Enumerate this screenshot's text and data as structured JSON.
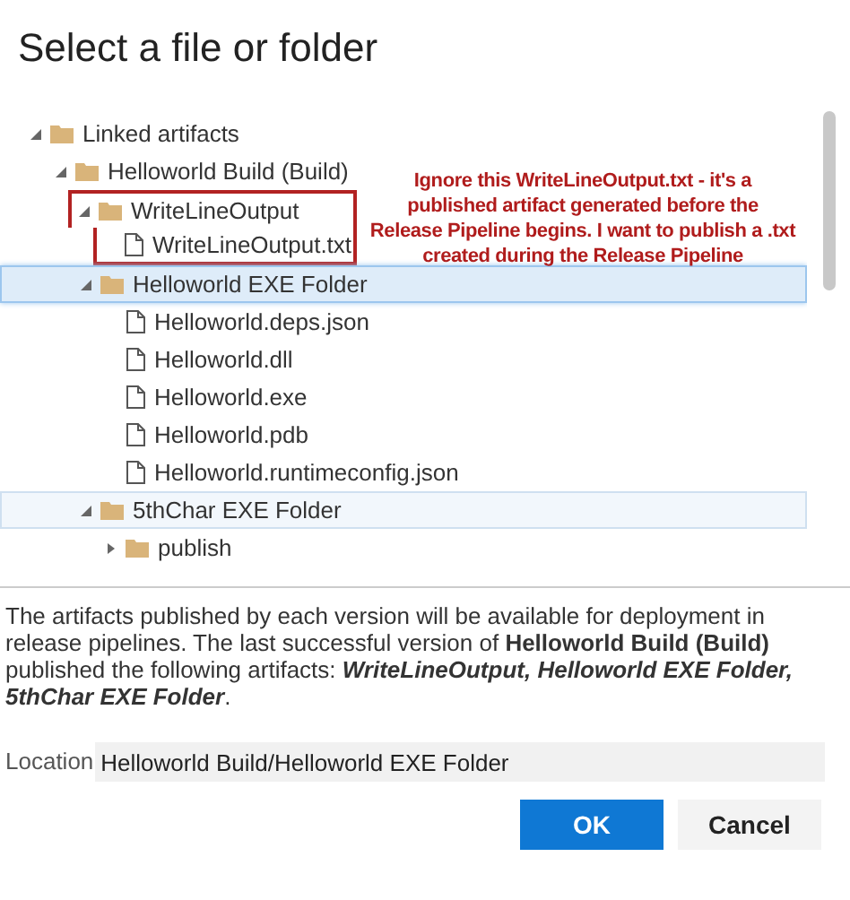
{
  "dialog": {
    "title": "Select a file or folder"
  },
  "tree": [
    {
      "kind": "folder",
      "label": "Linked artifacts",
      "expanded": true,
      "selected": false,
      "hovered": false,
      "annotated": false,
      "children": [
        {
          "kind": "folder",
          "label": "Helloworld Build (Build)",
          "expanded": true,
          "selected": false,
          "hovered": false,
          "annotated": false,
          "children": [
            {
              "kind": "folder",
              "label": "WriteLineOutput",
              "expanded": true,
              "selected": false,
              "hovered": false,
              "annotated": true,
              "children": [
                {
                  "kind": "file",
                  "label": "WriteLineOutput.txt",
                  "selected": false,
                  "hovered": false,
                  "annotated": true
                }
              ]
            },
            {
              "kind": "folder",
              "label": "Helloworld EXE Folder",
              "expanded": true,
              "selected": true,
              "hovered": false,
              "annotated": false,
              "children": [
                {
                  "kind": "file",
                  "label": "Helloworld.deps.json",
                  "selected": false,
                  "hovered": false,
                  "annotated": false
                },
                {
                  "kind": "file",
                  "label": "Helloworld.dll",
                  "selected": false,
                  "hovered": false,
                  "annotated": false
                },
                {
                  "kind": "file",
                  "label": "Helloworld.exe",
                  "selected": false,
                  "hovered": false,
                  "annotated": false
                },
                {
                  "kind": "file",
                  "label": "Helloworld.pdb",
                  "selected": false,
                  "hovered": false,
                  "annotated": false
                },
                {
                  "kind": "file",
                  "label": "Helloworld.runtimeconfig.json",
                  "selected": false,
                  "hovered": false,
                  "annotated": false
                }
              ]
            },
            {
              "kind": "folder",
              "label": "5thChar EXE Folder",
              "expanded": true,
              "selected": false,
              "hovered": true,
              "annotated": false,
              "children": [
                {
                  "kind": "folder",
                  "label": "publish",
                  "expanded": false,
                  "selected": false,
                  "hovered": false,
                  "annotated": false
                }
              ]
            }
          ]
        }
      ]
    }
  ],
  "annotation": {
    "text": "Ignore this WriteLineOutput.txt - it's a published artifact generated before the Release Pipeline begins. I want to publish a .txt created during the Release Pipeline"
  },
  "description": [
    {
      "kind": "plain",
      "text": "The artifacts published by each version will be available for deployment in release pipelines. The last successful version of "
    },
    {
      "kind": "bold",
      "text": "Helloworld Build (Build)"
    },
    {
      "kind": "plain",
      "text": " published the following artifacts: "
    },
    {
      "kind": "bold_italic",
      "text": "WriteLineOutput, Helloworld EXE Folder, 5thChar EXE Folder"
    },
    {
      "kind": "plain",
      "text": "."
    }
  ],
  "location": {
    "label": "Location",
    "value": "Helloworld Build/Helloworld EXE Folder"
  },
  "buttons": [
    {
      "kind": "primary",
      "label": "OK"
    },
    {
      "kind": "secondary",
      "label": "Cancel"
    }
  ]
}
